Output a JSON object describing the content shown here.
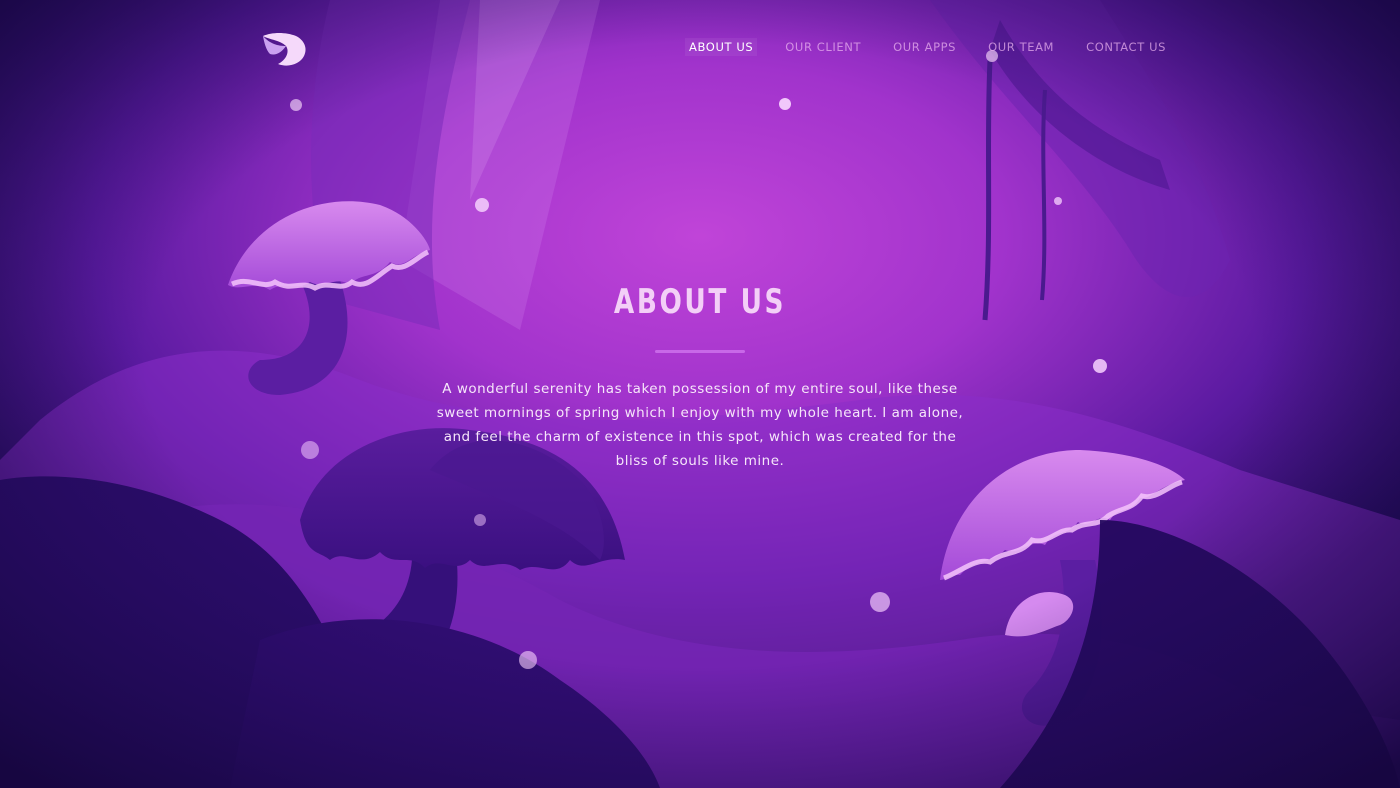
{
  "nav": {
    "items": [
      {
        "label": "ABOUT US",
        "active": true
      },
      {
        "label": "OUR CLIENT",
        "active": false
      },
      {
        "label": "OUR APPS",
        "active": false
      },
      {
        "label": "OUR TEAM",
        "active": false
      },
      {
        "label": "CONTACT US",
        "active": false
      }
    ]
  },
  "hero": {
    "title": "ABOUT US",
    "body": "A wonderful serenity has taken possession of my entire soul, like these sweet mornings of spring which I enjoy with my whole heart. I am alone, and feel the charm of existence in this spot, which was created for the bliss of souls like mine."
  },
  "logo": {
    "icon": "fox-head-icon"
  },
  "colors": {
    "background_deep": "#1e0a52",
    "background_glow": "#b43bd6",
    "mushroom_light": "#e39cf2",
    "accent_line": "#c868e8",
    "text_light": "#f6e6fa"
  }
}
